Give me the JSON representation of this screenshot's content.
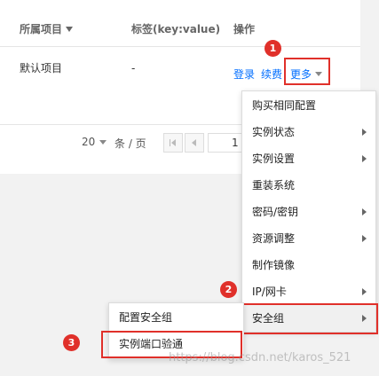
{
  "table": {
    "headers": {
      "project": "所属项目",
      "tags": "标签(key:value)",
      "actions": "操作"
    },
    "row": {
      "project": "默认项目",
      "tags": "-",
      "login": "登录",
      "renew": "续费",
      "more": "更多"
    }
  },
  "pagination": {
    "page_size": "20",
    "per_page_label": "条 / 页",
    "current_page": "1"
  },
  "menu": {
    "items": [
      {
        "label": "购买相同配置",
        "has_submenu": false
      },
      {
        "label": "实例状态",
        "has_submenu": true
      },
      {
        "label": "实例设置",
        "has_submenu": true
      },
      {
        "label": "重装系统",
        "has_submenu": false
      },
      {
        "label": "密码/密钥",
        "has_submenu": true
      },
      {
        "label": "资源调整",
        "has_submenu": true
      },
      {
        "label": "制作镜像",
        "has_submenu": false
      },
      {
        "label": "IP/网卡",
        "has_submenu": true
      },
      {
        "label": "安全组",
        "has_submenu": true,
        "active": true
      }
    ]
  },
  "submenu": {
    "items": [
      "配置安全组",
      "实例端口验通"
    ]
  },
  "markers": {
    "m1": "1",
    "m2": "2",
    "m3": "3"
  },
  "colors": {
    "link": "#006eff",
    "highlight": "#e0302a"
  },
  "watermark": "https://blog.csdn.net/karos_521"
}
